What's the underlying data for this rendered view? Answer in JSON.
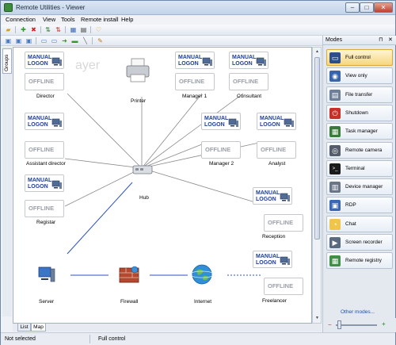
{
  "window": {
    "title": "Remote Utilities - Viewer",
    "min": "–",
    "max": "□",
    "close": "✕"
  },
  "menu": [
    "Connection",
    "View",
    "Tools",
    "Remote install",
    "Help"
  ],
  "side_tab": "Groups",
  "watermark": "ayer",
  "tabs": {
    "list": "List",
    "map": "Map"
  },
  "status": {
    "left": "Not selected",
    "right": "Full control"
  },
  "modes": {
    "title": "Modes",
    "pin": "⊓",
    "close": "✕",
    "other": "Other modes...",
    "zoom_minus": "−",
    "zoom_plus": "+",
    "items": [
      {
        "label": "Full control",
        "icon": "monitor-icon",
        "color": "#2b4f8a",
        "active": true
      },
      {
        "label": "View only",
        "icon": "monitor-eye-icon",
        "color": "#3a64a8",
        "active": false
      },
      {
        "label": "File transfer",
        "icon": "file-icon",
        "color": "#6e7f99",
        "active": false
      },
      {
        "label": "Shutdown",
        "icon": "power-icon",
        "color": "#c7302a",
        "active": false
      },
      {
        "label": "Task manager",
        "icon": "task-manager-icon",
        "color": "#3d7a3d",
        "active": false
      },
      {
        "label": "Remote camera",
        "icon": "camera-icon",
        "color": "#555d6a",
        "active": false
      },
      {
        "label": "Terminal",
        "icon": "terminal-icon",
        "color": "#1b1b1b",
        "active": false
      },
      {
        "label": "Device manager",
        "icon": "device-manager-icon",
        "color": "#6a7686",
        "active": false
      },
      {
        "label": "RDP",
        "icon": "rdp-icon",
        "color": "#3a68b4",
        "active": false
      },
      {
        "label": "Chat",
        "icon": "chat-icon",
        "color": "#f0c64a",
        "active": false
      },
      {
        "label": "Screen recorder",
        "icon": "screen-recorder-icon",
        "color": "#5a6b80",
        "active": false
      },
      {
        "label": "Remote registry",
        "icon": "registry-icon",
        "color": "#3f8f47",
        "active": false
      }
    ]
  },
  "status_text": {
    "manual_line1": "MANUAL",
    "manual_line2": "LOGON",
    "offline": "OFFLINE"
  },
  "nodes": [
    {
      "id": "director",
      "label": "Director",
      "state": "manual"
    },
    {
      "id": "printer",
      "label": "Printer",
      "state": "device"
    },
    {
      "id": "manager1",
      "label": "Manager 1",
      "state": "manual"
    },
    {
      "id": "consultant",
      "label": "Consultant",
      "state": "manual"
    },
    {
      "id": "assistant",
      "label": "Assistant director",
      "state": "manual"
    },
    {
      "id": "manager2",
      "label": "Manager 2",
      "state": "manual"
    },
    {
      "id": "analyst",
      "label": "Analyst",
      "state": "manual"
    },
    {
      "id": "registar",
      "label": "Registar",
      "state": "manual"
    },
    {
      "id": "hub",
      "label": "Hub",
      "state": "device"
    },
    {
      "id": "reception",
      "label": "Reception",
      "state": "manual"
    },
    {
      "id": "server",
      "label": "Server",
      "state": "device"
    },
    {
      "id": "firewall",
      "label": "Firewall",
      "state": "device"
    },
    {
      "id": "internet",
      "label": "Internet",
      "state": "device"
    },
    {
      "id": "freelancer",
      "label": "Freelancer",
      "state": "manual"
    }
  ]
}
